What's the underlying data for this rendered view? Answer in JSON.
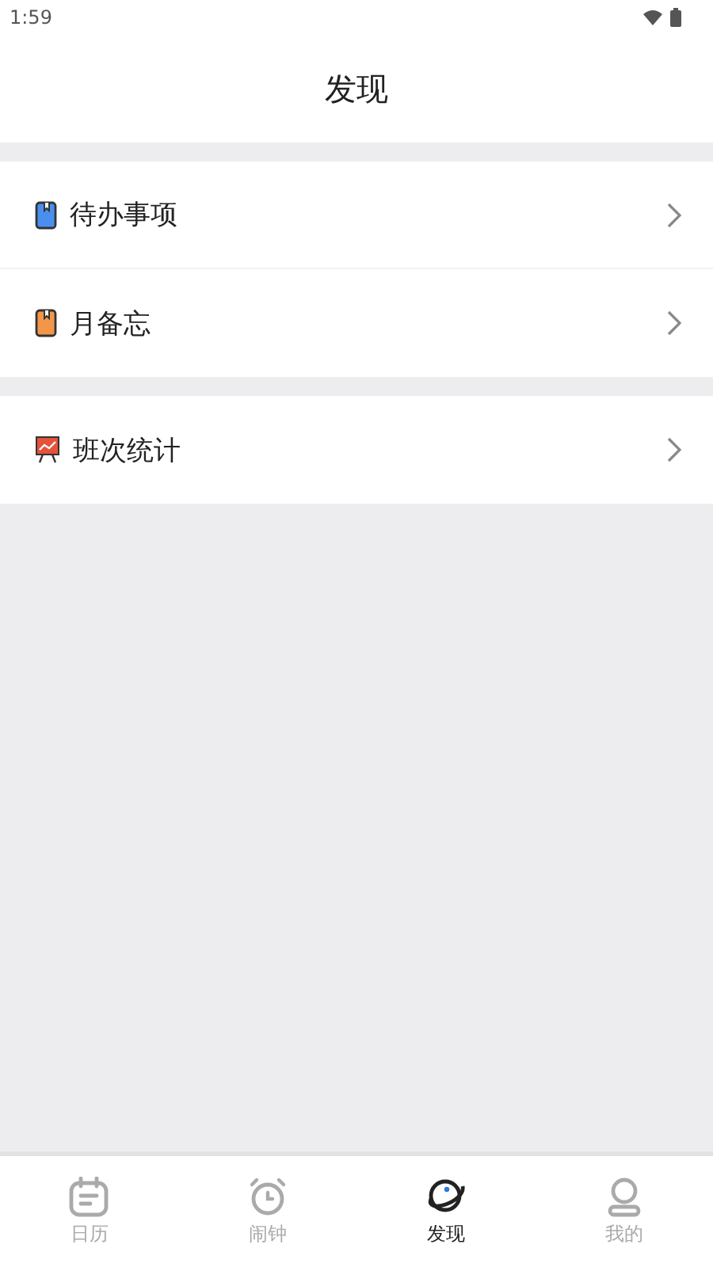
{
  "status_bar": {
    "time": "1:59"
  },
  "header": {
    "title": "发现"
  },
  "groups": [
    {
      "items": [
        {
          "label": "待办事项"
        },
        {
          "label": "月备忘"
        }
      ]
    },
    {
      "items": [
        {
          "label": "班次统计"
        }
      ]
    }
  ],
  "tabs": [
    {
      "label": "日历",
      "selected": false
    },
    {
      "label": "闹钟",
      "selected": false
    },
    {
      "label": "发现",
      "selected": true
    },
    {
      "label": "我的",
      "selected": false
    }
  ]
}
